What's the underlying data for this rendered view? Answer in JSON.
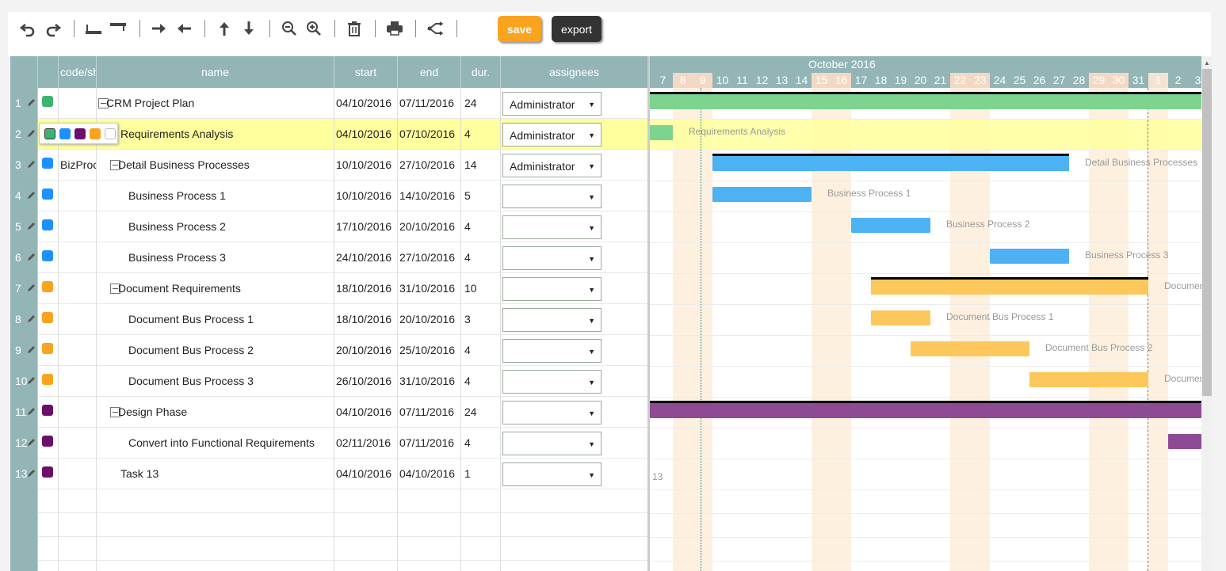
{
  "toolbar": {
    "save_label": "save",
    "export_label": "export"
  },
  "grid": {
    "headers": [
      "",
      "",
      "code/short",
      "name",
      "start",
      "end",
      "dur.",
      "assignees"
    ],
    "status_colors": {
      "green": "#3cb371",
      "blue": "#1e90ff",
      "orange": "#f9a31e",
      "purple": "#6b0f6b",
      "white": "#ffffff"
    },
    "rows": [
      {
        "num": "1",
        "status": "#3cb371",
        "code": "",
        "name": "CRM Project Plan",
        "level": 0,
        "collapsible": true,
        "start": "04/10/2016",
        "end": "07/11/2016",
        "dur": "24",
        "assignee": "Administrator"
      },
      {
        "num": "2",
        "status": "#3cb371",
        "code": "",
        "name": "Requirements Analysis",
        "level": 1,
        "collapsible": false,
        "start": "04/10/2016",
        "end": "07/10/2016",
        "dur": "4",
        "assignee": "Administrator",
        "selected": true
      },
      {
        "num": "3",
        "status": "#1e90ff",
        "code": "BizProc",
        "name": "Detail Business Processes",
        "level": 1,
        "collapsible": true,
        "start": "10/10/2016",
        "end": "27/10/2016",
        "dur": "14",
        "assignee": "Administrator"
      },
      {
        "num": "4",
        "status": "#1e90ff",
        "code": "",
        "name": "Business Process 1",
        "level": 2,
        "collapsible": false,
        "start": "10/10/2016",
        "end": "14/10/2016",
        "dur": "5",
        "assignee": ""
      },
      {
        "num": "5",
        "status": "#1e90ff",
        "code": "",
        "name": "Business Process 2",
        "level": 2,
        "collapsible": false,
        "start": "17/10/2016",
        "end": "20/10/2016",
        "dur": "4",
        "assignee": ""
      },
      {
        "num": "6",
        "status": "#1e90ff",
        "code": "",
        "name": "Business Process 3",
        "level": 2,
        "collapsible": false,
        "start": "24/10/2016",
        "end": "27/10/2016",
        "dur": "4",
        "assignee": ""
      },
      {
        "num": "7",
        "status": "#f9a31e",
        "code": "",
        "name": "Document Requirements",
        "level": 1,
        "collapsible": true,
        "start": "18/10/2016",
        "end": "31/10/2016",
        "dur": "10",
        "assignee": ""
      },
      {
        "num": "8",
        "status": "#f9a31e",
        "code": "",
        "name": "Document Bus Process 1",
        "level": 2,
        "collapsible": false,
        "start": "18/10/2016",
        "end": "20/10/2016",
        "dur": "3",
        "assignee": ""
      },
      {
        "num": "9",
        "status": "#f9a31e",
        "code": "",
        "name": "Document Bus Process 2",
        "level": 2,
        "collapsible": false,
        "start": "20/10/2016",
        "end": "25/10/2016",
        "dur": "4",
        "assignee": ""
      },
      {
        "num": "10",
        "status": "#f9a31e",
        "code": "",
        "name": "Document Bus Process 3",
        "level": 2,
        "collapsible": false,
        "start": "26/10/2016",
        "end": "31/10/2016",
        "dur": "4",
        "assignee": ""
      },
      {
        "num": "11",
        "status": "#6b0f6b",
        "code": "",
        "name": "Design Phase",
        "level": 1,
        "collapsible": true,
        "start": "04/10/2016",
        "end": "07/11/2016",
        "dur": "24",
        "assignee": ""
      },
      {
        "num": "12",
        "status": "#6b0f6b",
        "code": "",
        "name": "Convert into Functional Requirements",
        "level": 2,
        "collapsible": false,
        "start": "02/11/2016",
        "end": "07/11/2016",
        "dur": "4",
        "assignee": ""
      },
      {
        "num": "13",
        "status": "#6b0f6b",
        "code": "",
        "name": "Task 13",
        "level": 1,
        "collapsible": false,
        "start": "04/10/2016",
        "end": "04/10/2016",
        "dur": "1",
        "assignee": ""
      }
    ]
  },
  "gantt": {
    "month_label": "October 2016",
    "days": [
      "7",
      "8",
      "9",
      "10",
      "11",
      "12",
      "13",
      "14",
      "15",
      "16",
      "17",
      "18",
      "19",
      "20",
      "21",
      "22",
      "23",
      "24",
      "25",
      "26",
      "27",
      "28",
      "29",
      "30",
      "31",
      "1",
      "2",
      "3"
    ],
    "weekend_days": [
      "8",
      "9",
      "15",
      "16",
      "22",
      "23",
      "29",
      "30"
    ],
    "holiday_days": [
      "1"
    ],
    "bar_labels": {
      "r2": "Requirements Analysis",
      "r3": "Detail Business Processes",
      "r4": "Business Process 1",
      "r5": "Business Process 2",
      "r6": "Business Process 3",
      "r7": "Documen",
      "r8": "Document Bus Process 1",
      "r9": "Document Bus Process 2",
      "r10": "Documen",
      "r13": "13"
    },
    "colors": {
      "green": "#7dd48f",
      "blue": "#4db2f4",
      "orange": "#fcc85c",
      "purple": "#8f4a96",
      "weekend": "#fdf0df",
      "selected_row": "#ffff9d"
    }
  }
}
